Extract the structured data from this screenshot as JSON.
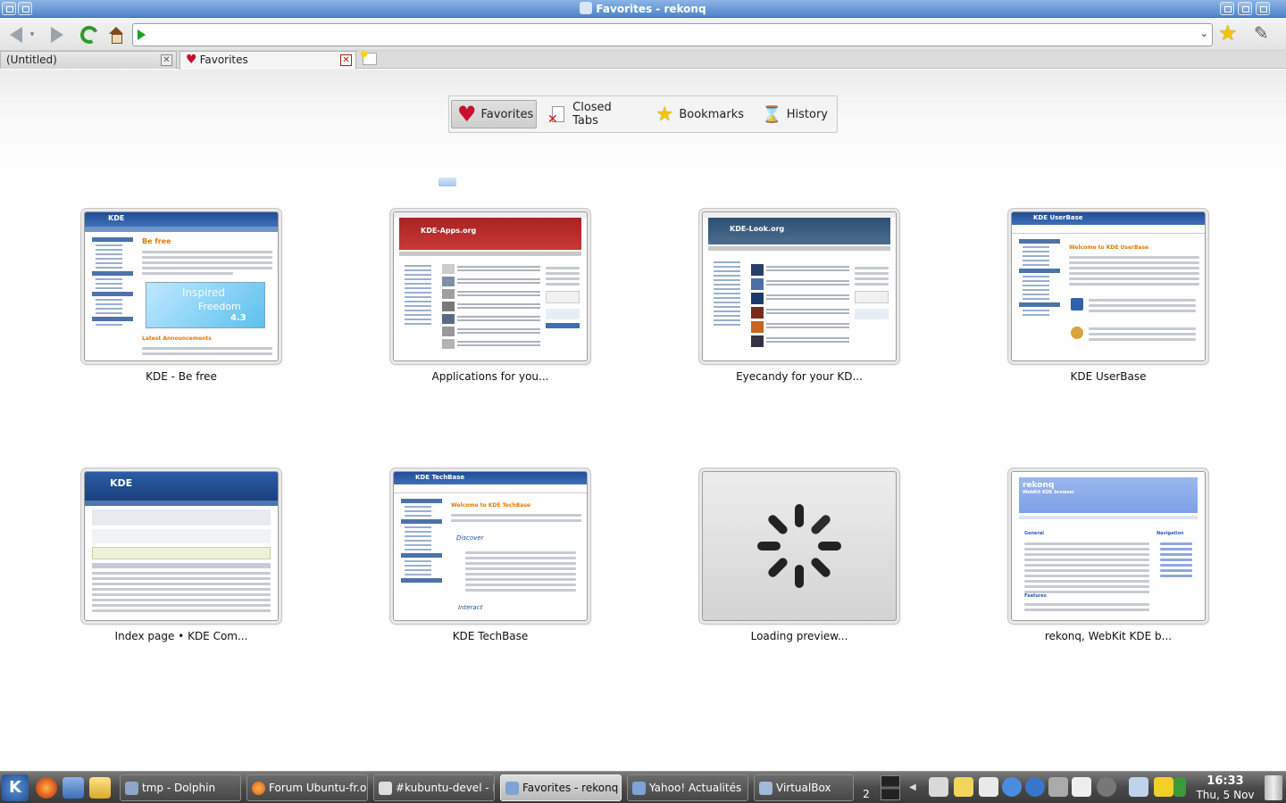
{
  "window": {
    "title": "Favorites - rekonq"
  },
  "toolbar": {
    "url_value": "",
    "dropdown_caret": "⌄"
  },
  "tabs": [
    {
      "label": "(Untitled)",
      "active": false
    },
    {
      "label": "Favorites",
      "active": true
    }
  ],
  "sections": [
    {
      "label": "Favorites",
      "icon": "heart-icon",
      "active": true
    },
    {
      "label": "Closed Tabs",
      "icon": "closed-tab-icon",
      "active": false
    },
    {
      "label": "Bookmarks",
      "icon": "star-icon",
      "active": false
    },
    {
      "label": "History",
      "icon": "hourglass-icon",
      "active": false
    }
  ],
  "previews": [
    {
      "caption": "KDE - Be free"
    },
    {
      "caption": "Applications for you..."
    },
    {
      "caption": "Eyecandy for your KD..."
    },
    {
      "caption": "KDE UserBase"
    },
    {
      "caption": "Index page • KDE Com..."
    },
    {
      "caption": "KDE TechBase"
    },
    {
      "caption": "Loading preview..."
    },
    {
      "caption": "rekonq, WebKit KDE b..."
    }
  ],
  "thumb_text": {
    "kde_brand": "KDE",
    "be_free": "Be free",
    "inspired": "Inspired",
    "freedom": "Freedom",
    "version": "4.3",
    "announcements": "Latest Announcements",
    "userbase_title": "KDE UserBase",
    "userbase_welcome": "Welcome to KDE UserBase",
    "techbase_title": "KDE TechBase",
    "techbase_welcome": "Welcome to KDE TechBase",
    "discover": "Discover",
    "interact": "Interact",
    "rekonq_title": "rekonq",
    "rekonq_sub": "WebKit KDE browser",
    "general": "General",
    "features": "Features",
    "navigation": "Navigation",
    "kde_apps": "KDE-Apps.org",
    "kde_look": "KDE-Look.org"
  },
  "taskbar": {
    "tasks": [
      {
        "label": "tmp - Dolphin",
        "active": false
      },
      {
        "label": "Forum Ubuntu-fr.o",
        "active": false
      },
      {
        "label": "#kubuntu-devel - I",
        "active": false
      },
      {
        "label": "Favorites - rekonq",
        "active": true
      },
      {
        "label": "Yahoo! Actualités",
        "active": false
      },
      {
        "label": "VirtualBox",
        "active": false
      }
    ],
    "pager_count": "2",
    "clock": {
      "time": "16:33",
      "date": "Thu, 5 Nov"
    }
  },
  "colors": {
    "accent": "#4f84c9",
    "heart": "#c8102e",
    "star": "#f2c400"
  }
}
